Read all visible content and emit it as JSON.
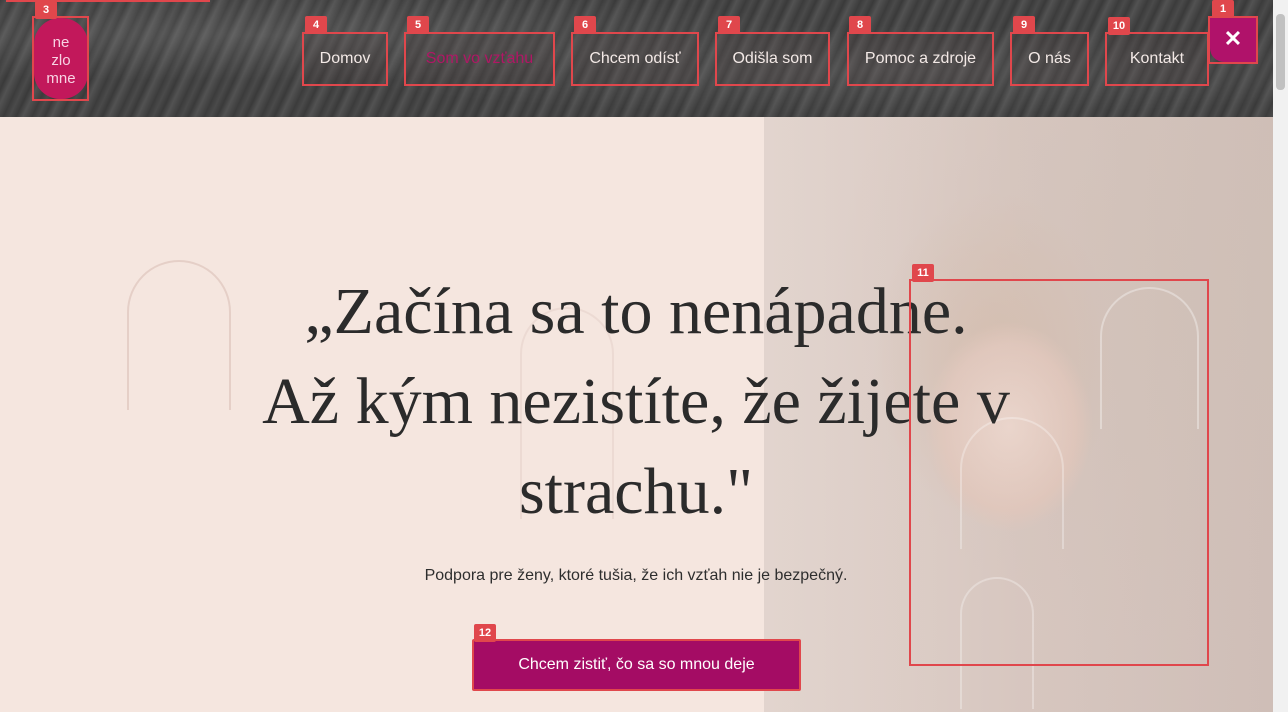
{
  "header": {
    "logo_text": "ne zlo mne",
    "close_symbol": "✕",
    "nav": [
      {
        "label": "Domov",
        "active": false
      },
      {
        "label": "Som vo vzťahu",
        "active": true
      },
      {
        "label": "Chcem odísť",
        "active": false
      },
      {
        "label": "Odišla som",
        "active": false
      },
      {
        "label": "Pomoc a zdroje",
        "active": false
      },
      {
        "label": "O nás",
        "active": false
      },
      {
        "label": "Kontakt",
        "active": false
      }
    ]
  },
  "hero": {
    "headline_line1": "„Začína sa to nenápadne.",
    "headline_line2": "Až kým nezistíte, že žijete v",
    "headline_line3": "strachu.\"",
    "subtitle": "Podpora pre ženy, ktoré tušia, že ich vzťah nie je bezpečný.",
    "cta_label": "Chcem zistiť, čo sa so mnou deje"
  },
  "markers": [
    "1",
    "3",
    "4",
    "5",
    "6",
    "7",
    "8",
    "9",
    "10",
    "11",
    "12"
  ],
  "colors": {
    "brand": "#b0126a",
    "cta": "#a40c64",
    "background": "#f5e6df",
    "annotation": "#e0474c"
  }
}
